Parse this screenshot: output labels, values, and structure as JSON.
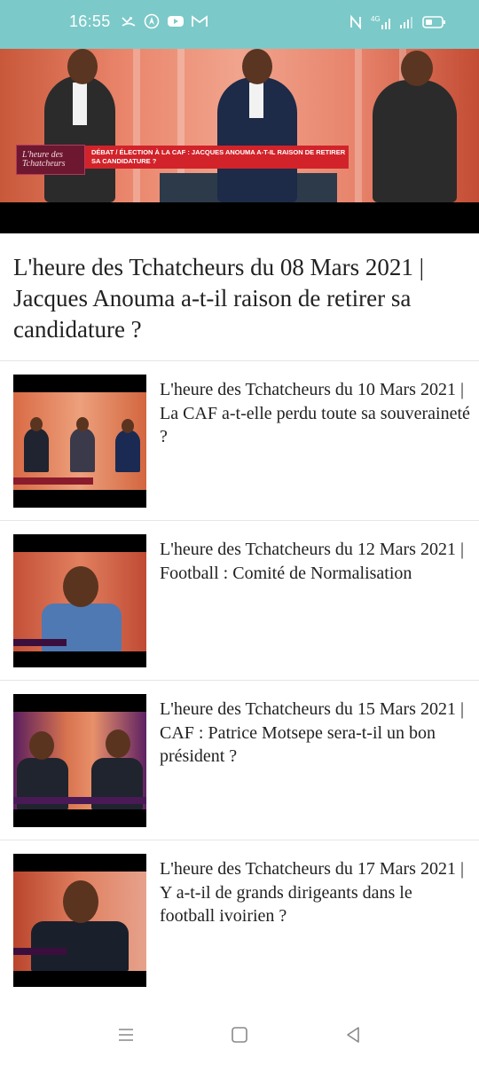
{
  "status_bar": {
    "time": "16:55",
    "icons_left": [
      "missed-call-icon",
      "navigation-icon",
      "youtube-icon",
      "gmail-icon"
    ],
    "icons_right": [
      "nfc-icon",
      "4g-signal-icon",
      "cell-signal-icon",
      "battery-icon"
    ],
    "color": "#7cc9c9"
  },
  "hero": {
    "logo_text": "L'heure des Tchatcheurs",
    "banner_text": "DÉBAT / ÉLECTION À LA CAF : JACQUES ANOUMA A-T-IL RAISON DE RETIRER SA CANDIDATURE ?",
    "banner_color": "#d2232a"
  },
  "main": {
    "title": "L'heure des Tchatcheurs du 08 Mars 2021 | Jacques Anouma a-t-il raison de retirer sa candidature ?"
  },
  "videos": [
    {
      "title": "L'heure des Tchatcheurs du 10 Mars 2021 | La CAF a-t-elle perdu toute sa souveraineté ?"
    },
    {
      "title": "L'heure des Tchatcheurs du 12 Mars 2021 | Football : Comité de Normalisation"
    },
    {
      "title": "L'heure des Tchatcheurs du 15 Mars 2021 | CAF : Patrice Motsepe sera-t-il un bon président ?"
    },
    {
      "title": "L'heure des Tchatcheurs du 17 Mars 2021 | Y a-t-il de grands dirigeants dans le football ivoirien ?"
    }
  ],
  "nav_bar": {
    "buttons": [
      "menu-icon",
      "home-icon",
      "back-icon"
    ]
  }
}
